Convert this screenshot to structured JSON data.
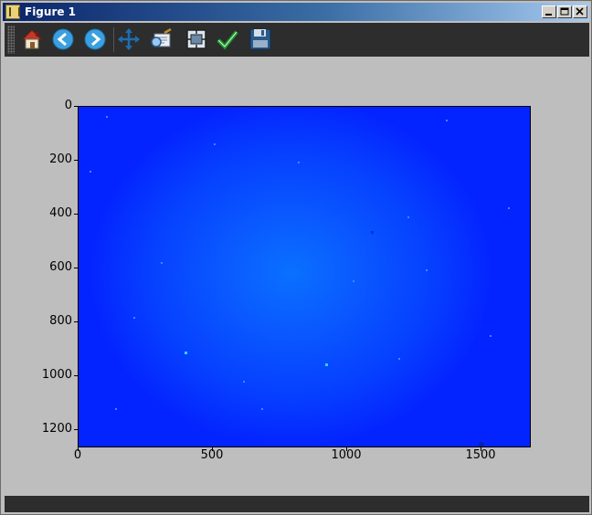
{
  "window": {
    "title": "Figure 1"
  },
  "titlebar_buttons": [
    "minimize",
    "maximize",
    "close"
  ],
  "toolbar": {
    "buttons": [
      {
        "name": "home",
        "icon": "home-icon"
      },
      {
        "name": "back",
        "icon": "back-arrow-icon"
      },
      {
        "name": "forward",
        "icon": "forward-arrow-icon"
      },
      {
        "name": "pan",
        "icon": "move-icon"
      },
      {
        "name": "zoom",
        "icon": "zoom-rect-icon"
      },
      {
        "name": "subplots",
        "icon": "subplots-icon"
      },
      {
        "name": "edit",
        "icon": "checkmark-icon"
      },
      {
        "name": "save",
        "icon": "floppy-disk-icon"
      }
    ]
  },
  "image_plot": {
    "y_ticks": [
      "0",
      "200",
      "400",
      "600",
      "800",
      "1000",
      "1200"
    ],
    "x_ticks": [
      "0",
      "500",
      "1000",
      "1500"
    ],
    "colors": {
      "dark": "#0424ff",
      "center": "#0a70ff"
    }
  },
  "status": {
    "text": ""
  }
}
